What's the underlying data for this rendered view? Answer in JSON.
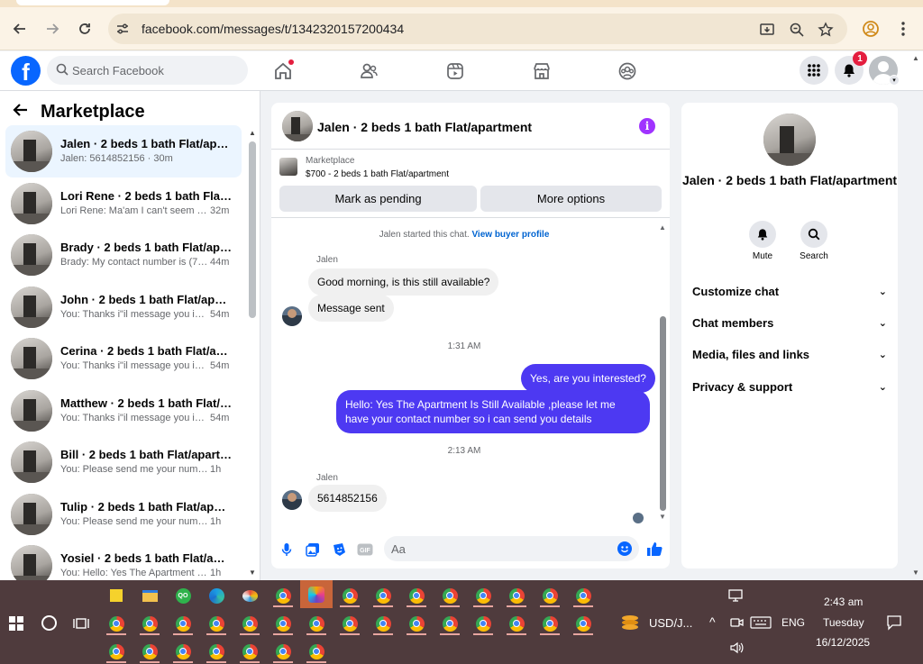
{
  "browser": {
    "url": "facebook.com/messages/t/1342320157200434"
  },
  "facebook": {
    "search_placeholder": "Search Facebook",
    "notification_count": "1"
  },
  "left": {
    "title": "Marketplace",
    "conversations": [
      {
        "name": "Jalen · 2 beds 1 bath Flat/apart...",
        "preview": "Jalen: 5614852156 · 30m",
        "time": "",
        "active": true
      },
      {
        "name": "Lori Rene · 2 beds 1 bath Flat/a...",
        "preview": "Lori Rene: Ma'am I can't seem to...",
        "time": "32m"
      },
      {
        "name": "Brady · 2 beds 1 bath Flat/apart...",
        "preview": "Brady: My contact number is (72...",
        "time": "44m"
      },
      {
        "name": "John · 2 beds 1 bath Flat/apart...",
        "preview": "You: Thanks i\"il message you in ...",
        "time": "54m"
      },
      {
        "name": "Cerina · 2 beds 1 bath Flat/apart...",
        "preview": "You: Thanks i\"il message you in ...",
        "time": "54m"
      },
      {
        "name": "Matthew · 2 beds 1 bath Flat/ap...",
        "preview": "You: Thanks i\"il message you in ...",
        "time": "54m"
      },
      {
        "name": "Bill · 2 beds 1 bath Flat/apartment",
        "preview": "You: Please send me your number ...",
        "time": "1h"
      },
      {
        "name": "Tulip · 2 beds 1 bath Flat/apart...",
        "preview": "You: Please send me your number ...",
        "time": "1h"
      },
      {
        "name": "Yosiel · 2 beds 1 bath Flat/apart...",
        "preview": "You: Hello: Yes The Apartment Is St...",
        "time": "1h"
      }
    ]
  },
  "chat": {
    "title": "Jalen · 2 beds 1 bath Flat/apartment",
    "listing_source": "Marketplace",
    "listing_price": "$700 - 2 beds 1 bath Flat/apartment",
    "btn_pending": "Mark as pending",
    "btn_more": "More options",
    "system_text": "Jalen started this chat.",
    "system_link": "View buyer profile",
    "sender1": "Jalen",
    "msg1": "Good morning, is this still available?",
    "msg2": "Message sent",
    "time1": "1:31 AM",
    "msg3": "Yes, are you interested?",
    "msg4": "Hello: Yes The Apartment Is Still Available ,please let me have your contact number so i can send you details",
    "time2": "2:13 AM",
    "sender2": "Jalen",
    "msg5": "5614852156",
    "composer_placeholder": "Aa"
  },
  "right": {
    "name": "Jalen · 2 beds 1 bath Flat/apartment",
    "mute": "Mute",
    "search": "Search",
    "sections": [
      "Customize chat",
      "Chat members",
      "Media, files and links",
      "Privacy & support"
    ]
  },
  "taskbar": {
    "currency": "USD/J...",
    "lang": "ENG",
    "time": "2:43 am",
    "day": "Tuesday",
    "date": "16/12/2025"
  },
  "colors": {
    "fb_blue": "#0866ff",
    "outgoing_bubble": "#4d39f2",
    "taskbar": "#4f3b3d"
  }
}
